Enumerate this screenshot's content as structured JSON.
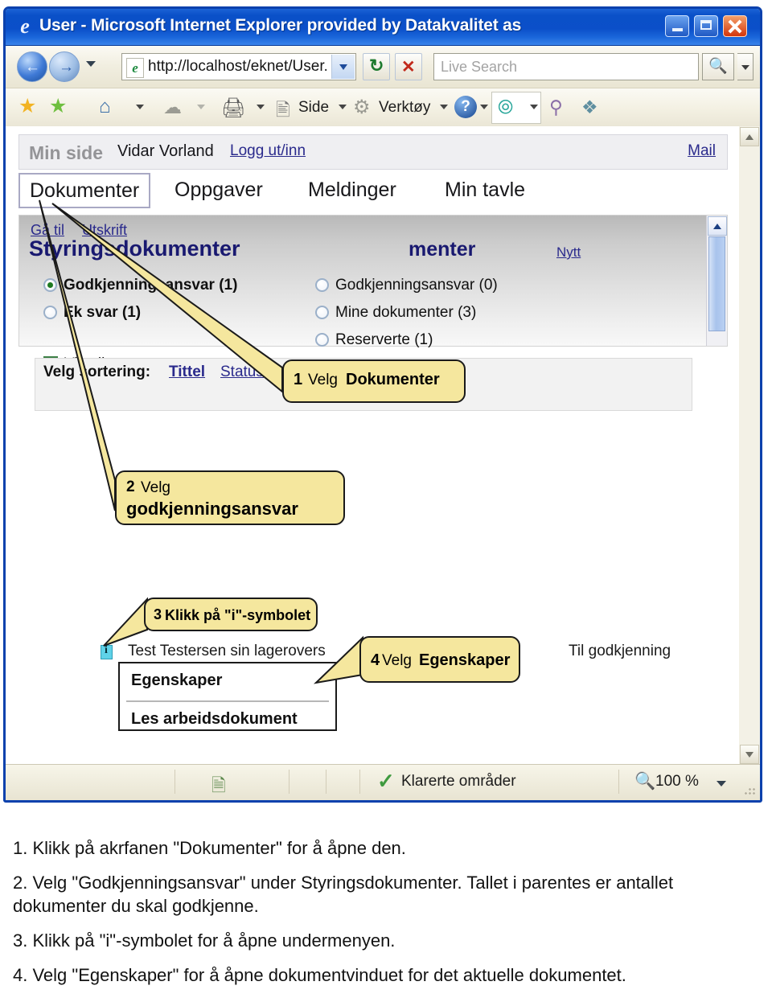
{
  "browser": {
    "title": "User - Microsoft Internet Explorer provided by Datakvalitet as",
    "window_buttons": {
      "minimize": "minimize-button",
      "maximize": "maximize-button",
      "close": "close-button"
    },
    "address": {
      "url": "http://localhost/eknet/User.",
      "favicon": "e",
      "dropdown": "address-dropdown"
    },
    "search": {
      "placeholder": "Live Search",
      "value": ""
    },
    "command_bar": {
      "side_label": "Side",
      "verktoy_label": "Verktøy"
    },
    "statusbar": {
      "zone": "Klarerte områder",
      "zoom": "100 %"
    }
  },
  "page": {
    "topbar": {
      "my_page": "Min side",
      "user": "Vidar Vorland",
      "logout": "Logg ut/inn",
      "mail": "Mail"
    },
    "tabs": [
      {
        "label": "Dokumenter",
        "active": true
      },
      {
        "label": "Oppgaver",
        "active": false
      },
      {
        "label": "Meldinger",
        "active": false
      },
      {
        "label": "Min tavle",
        "active": false
      }
    ],
    "links": {
      "gatil": "Gå til",
      "utskrift": "Utskrift",
      "nytt": "Nytt"
    },
    "headings": {
      "left": "Styringsdokumenter",
      "right": "menter"
    },
    "radios_left": [
      {
        "label": "Godkjenningsansvar (1)",
        "selected": true
      },
      {
        "label": "Ek         svar (1)",
        "selected": false
      }
    ],
    "radios_right": [
      {
        "label": "Godkjenningsansvar (0)",
        "selected": false
      },
      {
        "label": "Mine dokumenter (3)",
        "selected": false
      },
      {
        "label": "Reserverte (1)",
        "selected": false
      }
    ],
    "checkbox": {
      "label": "Vis alle",
      "checked": true
    },
    "sorting": {
      "label": "Velg sortering:",
      "option_tittel": "Tittel",
      "option_status": "Status"
    },
    "document": {
      "info_icon": "i",
      "title": "Test Testersen sin lagerovers",
      "status": "Til godkjenning"
    },
    "submenu": [
      {
        "label": "Egenskaper"
      },
      {
        "label": "Les arbeidsdokument"
      }
    ]
  },
  "callouts": [
    {
      "number": "1",
      "text_normal": "Velg",
      "text_bold": "Dokumenter"
    },
    {
      "number": "2",
      "text_normal": "Velg",
      "text_bold": "godkjenningsansvar"
    },
    {
      "number": "3",
      "text_normal": "",
      "text_bold": "Klikk på \"i\"-symbolet"
    },
    {
      "number": "4",
      "text_normal": "Velg",
      "text_bold": "Egenskaper"
    }
  ],
  "instructions": [
    "1. Klikk på akrfanen \"Dokumenter\" for å åpne den.",
    "2. Velg \"Godkjenningsansvar\" under Styringsdokumenter. Tallet i parentes er antallet dokumenter du skal godkjenne.",
    "3. Klikk på \"i\"-symbolet for å åpne undermenyen.",
    "4. Velg \"Egenskaper\" for å åpne dokumentvinduet for det aktuelle dokumentet."
  ],
  "colors": {
    "titlebar": "#0b4fc9",
    "callout_fill": "#f5e79e",
    "heading": "#191970",
    "link": "#2a2a8c",
    "info_icon": "#5fd2e8",
    "scroll_thumb": "#a8c3ec"
  }
}
